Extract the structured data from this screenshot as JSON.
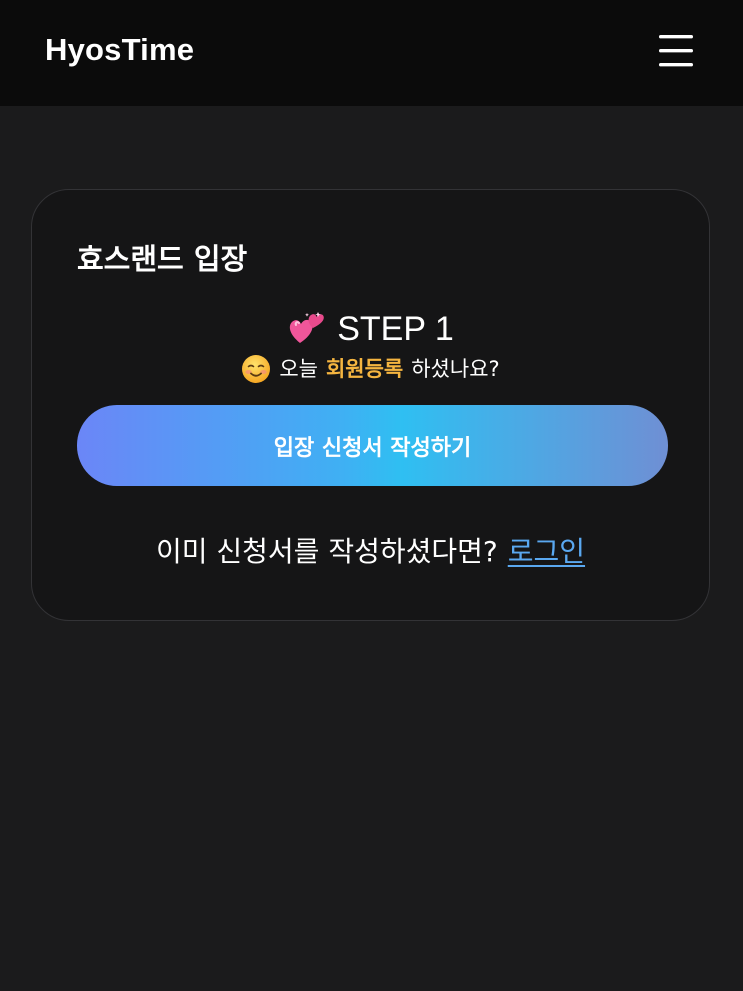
{
  "header": {
    "logo": "HyosTime",
    "menu_icon": "hamburger-menu-icon"
  },
  "card": {
    "title": "효스랜드 입장",
    "step": {
      "icon": "two-hearts-icon",
      "label": "STEP 1"
    },
    "subtitle": {
      "icon": "smiling-face-icon",
      "prefix": "오늘",
      "highlight": "회원등록",
      "suffix": "하셨나요?"
    },
    "apply_button_label": "입장 신청서 작성하기",
    "login_prompt": "이미 신청서를 작성하셨다면?",
    "login_link": "로그인"
  },
  "colors": {
    "background": "#1b1b1c",
    "header": "#0b0b0b",
    "card": "#151516",
    "highlight": "#f5b540",
    "link": "#5aa8f0",
    "button_gradient_start": "#6b86f7",
    "button_gradient_mid": "#2fbff2",
    "button_gradient_end": "#6f8fd4"
  }
}
